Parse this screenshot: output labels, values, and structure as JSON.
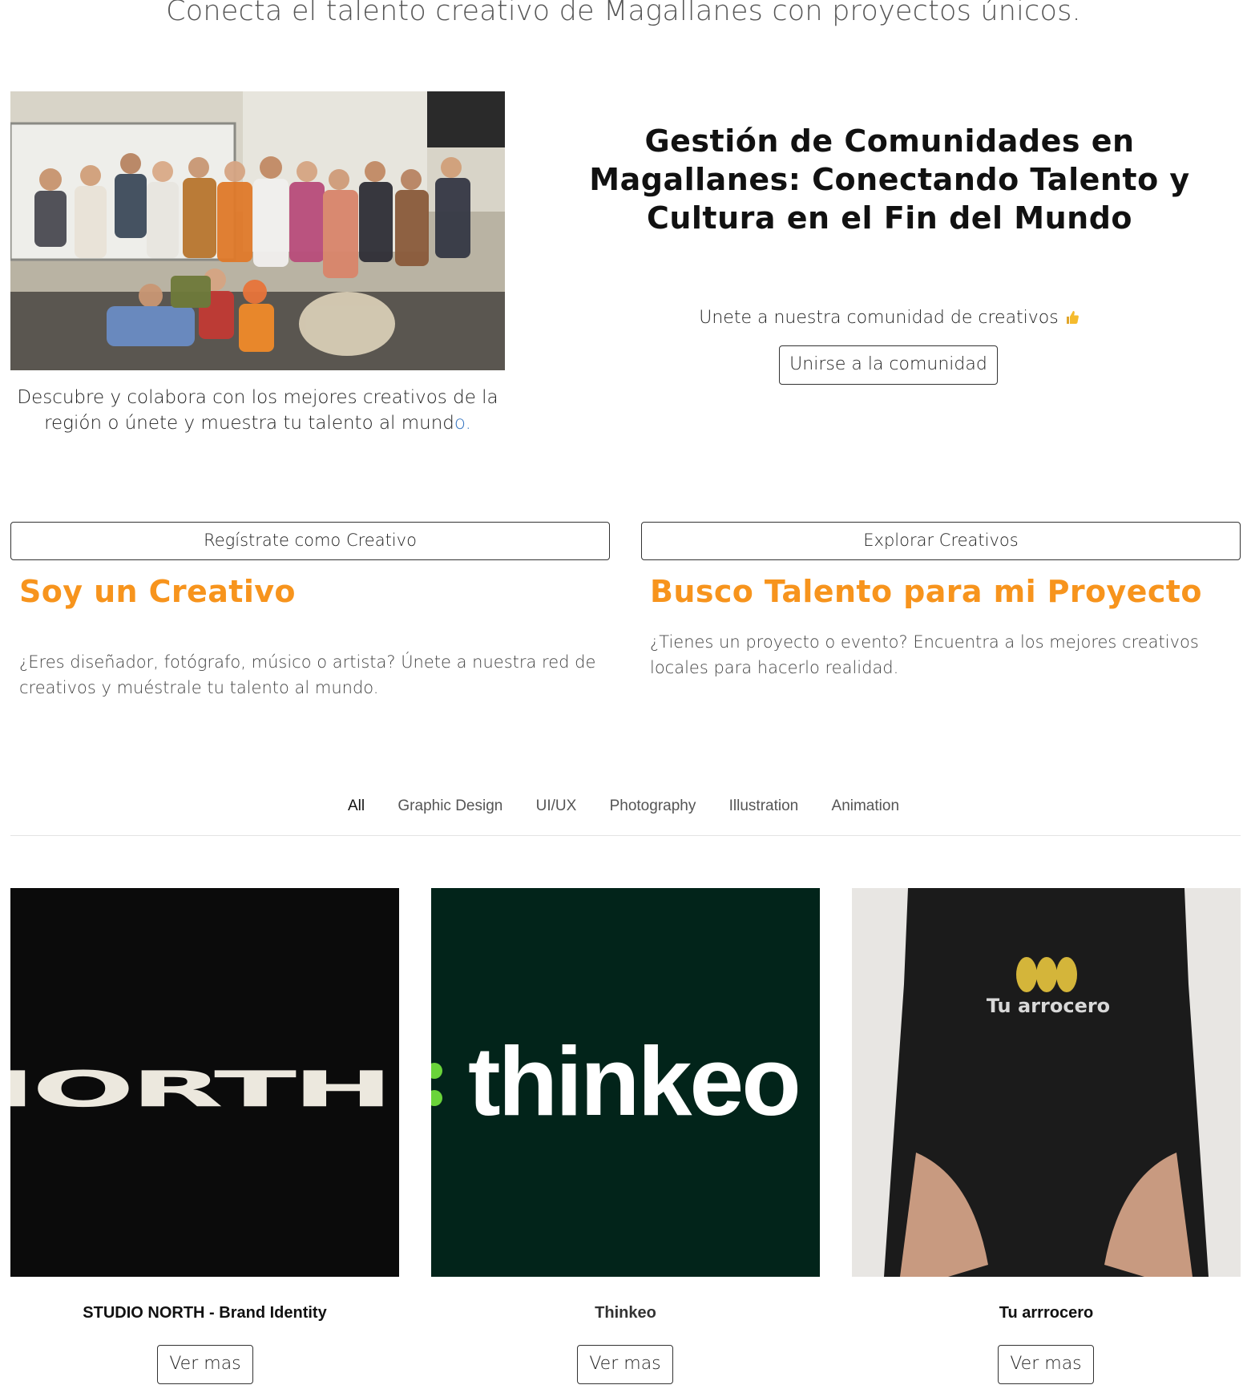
{
  "tagline": "Conecta el talento creativo de Magallanes con proyectos únicos.",
  "hero": {
    "caption_main": "Descubre y colabora con los mejores creativos de la región o únete y muestra tu talento al mund",
    "caption_tail": "o.",
    "title": "Gestión de Comunidades en Magallanes: Conectando Talento y Cultura en el Fin del Mundo",
    "join_text": "Unete a nuestra comunidad de creativos",
    "join_button": "Unirse a la comunidad"
  },
  "actions": {
    "register_button": "Regístrate como Creativo",
    "explore_button": "Explorar Creativos"
  },
  "creative": {
    "heading": "Soy un Creativo",
    "text": "¿Eres diseñador, fotógrafo, músico o artista? Únete a nuestra red de creativos y muéstrale tu talento al mundo."
  },
  "talent": {
    "heading": "Busco Talento para mi Proyecto",
    "text": "¿Tienes un proyecto o evento? Encuentra a los mejores creativos locales para hacerlo realidad."
  },
  "filters": [
    "All",
    "Graphic Design",
    "UI/UX",
    "Photography",
    "Illustration",
    "Animation"
  ],
  "filter_active": "All",
  "projects": [
    {
      "title": "STUDIO NORTH - Brand Identity",
      "image_text": "NORTH",
      "button": "Ver mas"
    },
    {
      "title": "Thinkeo",
      "image_text": "thinkeo",
      "button": "Ver mas"
    },
    {
      "title": "Tu arrrocero",
      "image_text": "Tu arrocero",
      "button": "Ver mas"
    }
  ],
  "colors": {
    "accent_orange": "#f7941d",
    "thinkeo_bg": "#02241a",
    "thinkeo_dot": "#6ad43a",
    "arroz_gold": "#d4b53a"
  }
}
